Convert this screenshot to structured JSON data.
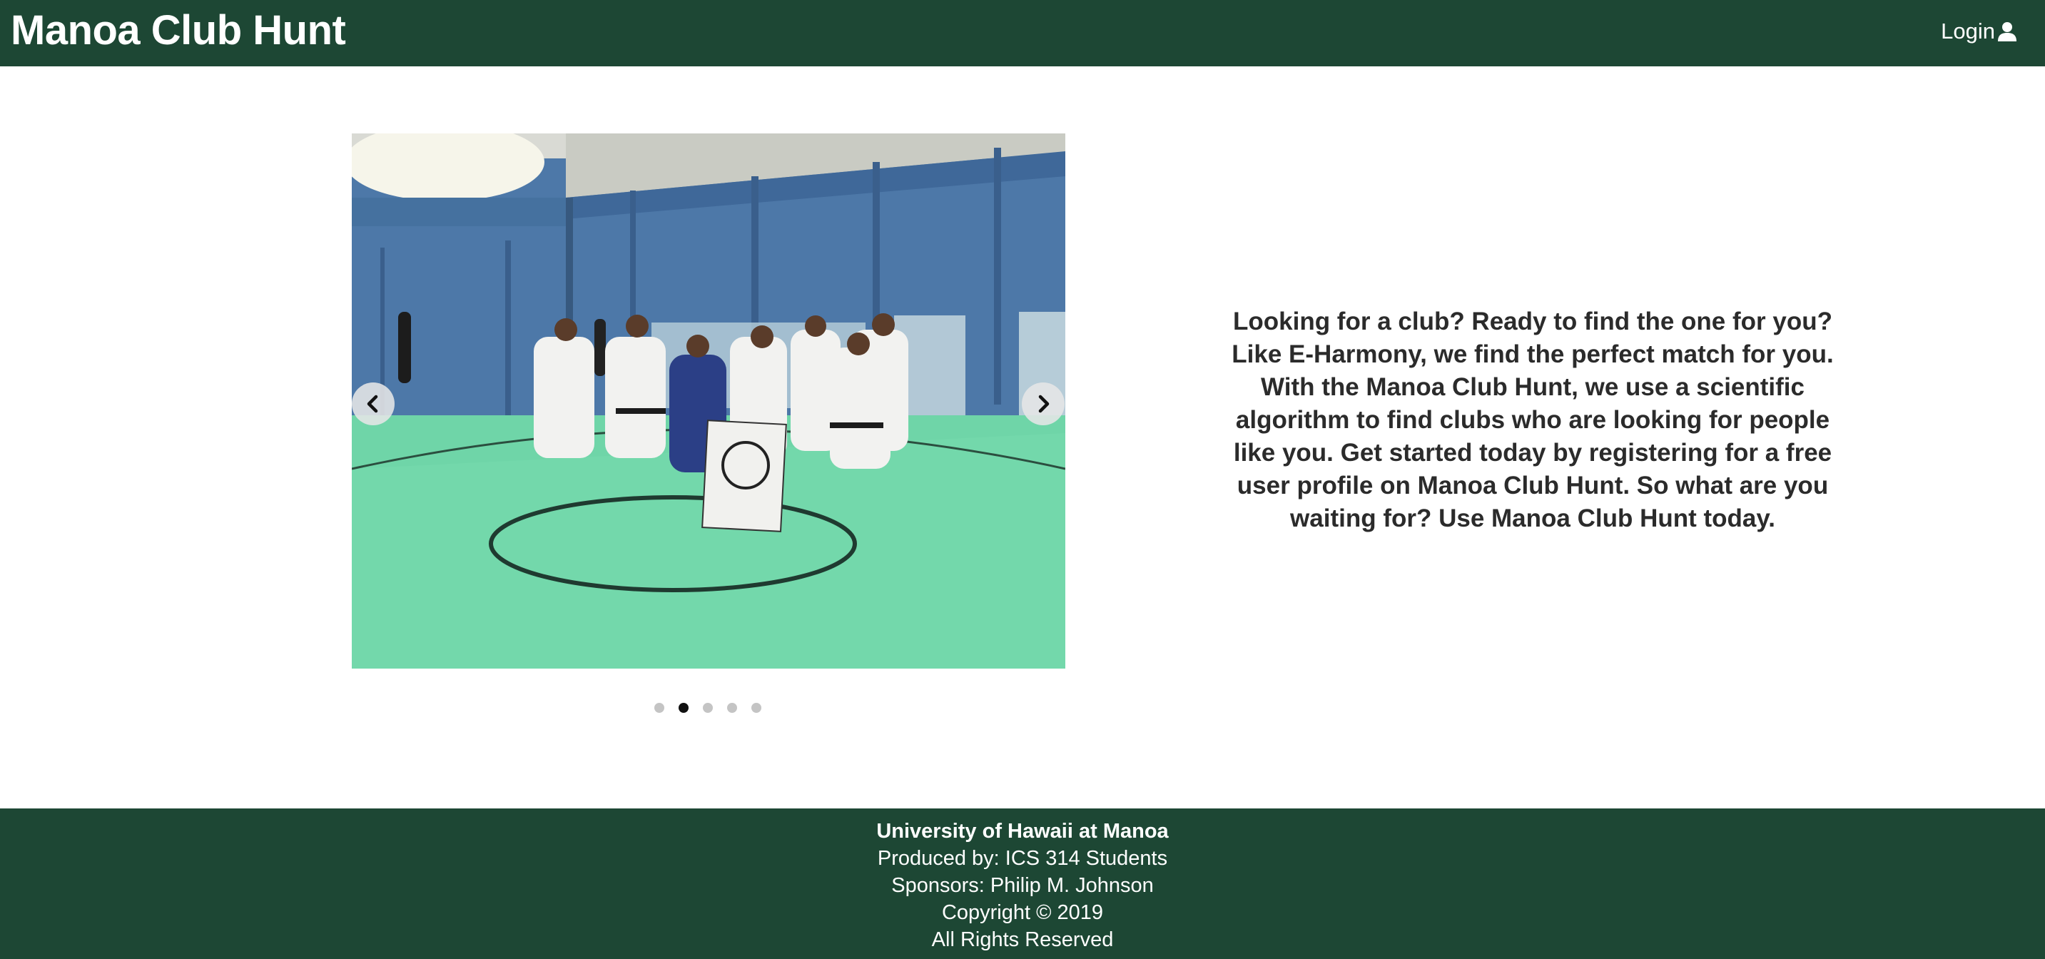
{
  "navbar": {
    "brand": "Manoa Club Hunt",
    "login_label": "Login",
    "login_icon": "user-icon",
    "background_color": "#1d4734"
  },
  "carousel": {
    "slide_description_icon": "photo",
    "prev_icon": "chevron-left-icon",
    "next_icon": "chevron-right-icon",
    "indicator_count": 5,
    "active_indicator": 2
  },
  "tagline": "Looking for a club? Ready to find the one for you? Like E-Harmony, we find the perfect match for you. With the Manoa Club Hunt, we use a scientific algorithm to find clubs who are looking for people like you. Get started today by registering for a free user profile on Manoa Club Hunt. So what are you waiting for? Use Manoa Club Hunt today.",
  "footer": {
    "lines": [
      "University of Hawaii at Manoa",
      "Produced by: ICS 314 Students",
      "Sponsors: Philip M. Johnson",
      "Copyright © 2019",
      "All Rights Reserved"
    ],
    "background_color": "#1d4734"
  }
}
